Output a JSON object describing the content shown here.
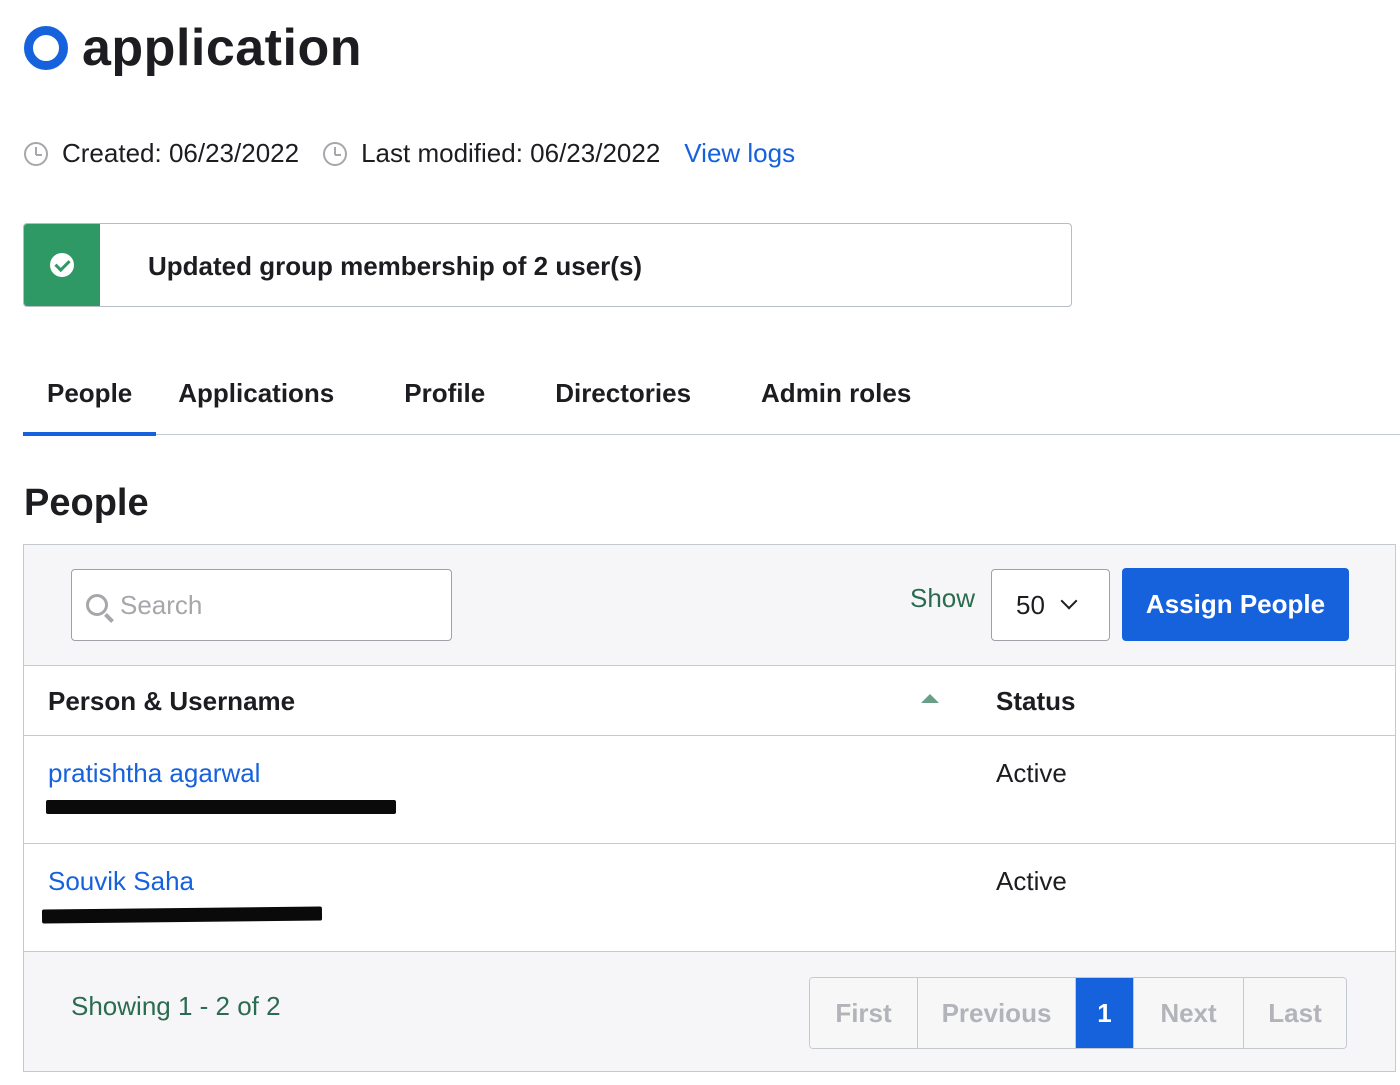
{
  "header": {
    "title": "application"
  },
  "meta": {
    "created": "Created: 06/23/2022",
    "modified": "Last modified: 06/23/2022",
    "view_logs": "View logs"
  },
  "banner": {
    "message": "Updated group membership of 2 user(s)"
  },
  "tabs": [
    {
      "label": "People",
      "active": true
    },
    {
      "label": "Applications",
      "active": false
    },
    {
      "label": "Profile",
      "active": false
    },
    {
      "label": "Directories",
      "active": false
    },
    {
      "label": "Admin roles",
      "active": false
    }
  ],
  "section": {
    "title": "People"
  },
  "toolbar": {
    "search_placeholder": "Search",
    "show_label": "Show",
    "page_size": "50",
    "assign_button": "Assign People"
  },
  "table": {
    "columns": [
      "Person & Username",
      "Status"
    ],
    "rows": [
      {
        "name": "pratishtha agarwal",
        "status": "Active"
      },
      {
        "name": "Souvik Saha",
        "status": "Active"
      }
    ]
  },
  "footer": {
    "showing": "Showing 1 - 2 of 2",
    "pager": [
      "First",
      "Previous",
      "1",
      "Next",
      "Last"
    ]
  },
  "colors": {
    "accent": "#1662dd",
    "success": "#2f9966",
    "muted_green_text": "#2b6b4f"
  }
}
